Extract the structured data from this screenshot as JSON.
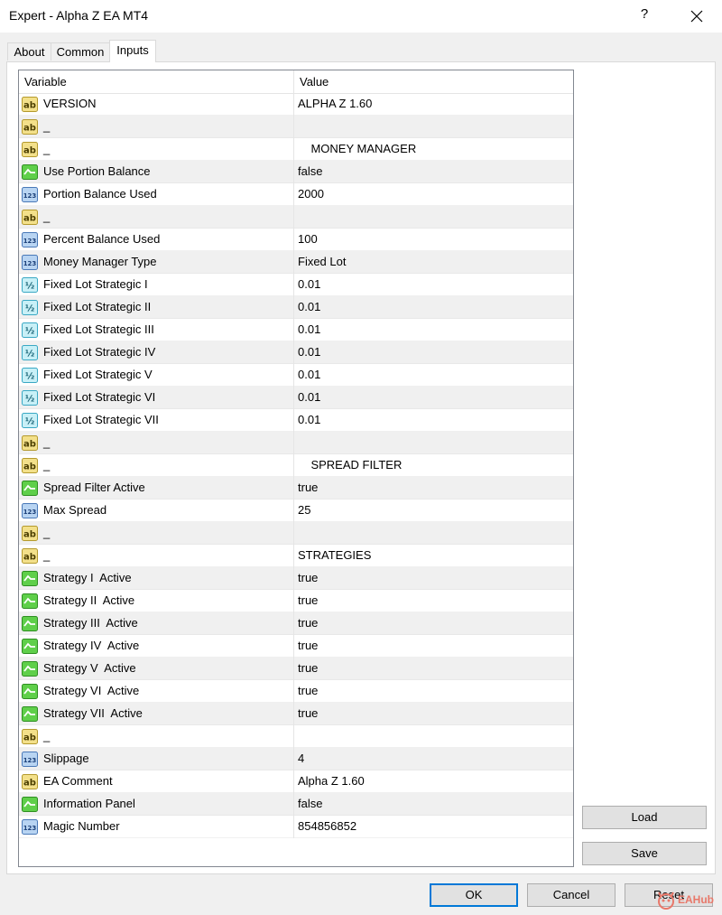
{
  "window": {
    "title": "Expert - Alpha Z EA MT4",
    "help_label": "?"
  },
  "tabs": [
    "About",
    "Common",
    "Inputs"
  ],
  "grid": {
    "headers": {
      "variable": "Variable",
      "value": "Value"
    },
    "rows": [
      {
        "icon": "ab",
        "name": "VERSION",
        "value": "ALPHA Z 1.60"
      },
      {
        "icon": "ab",
        "name": "_",
        "value": ""
      },
      {
        "icon": "ab",
        "name": "_",
        "value": "    MONEY MANAGER"
      },
      {
        "icon": "bool",
        "name": "Use Portion Balance",
        "value": "false"
      },
      {
        "icon": "int",
        "name": "Portion Balance Used",
        "value": "2000"
      },
      {
        "icon": "ab",
        "name": "_",
        "value": ""
      },
      {
        "icon": "int",
        "name": "Percent Balance Used",
        "value": "100"
      },
      {
        "icon": "int",
        "name": "Money Manager Type",
        "value": "Fixed Lot"
      },
      {
        "icon": "double",
        "name": "Fixed Lot Strategic I",
        "value": "0.01"
      },
      {
        "icon": "double",
        "name": "Fixed Lot Strategic II",
        "value": "0.01"
      },
      {
        "icon": "double",
        "name": "Fixed Lot Strategic III",
        "value": "0.01"
      },
      {
        "icon": "double",
        "name": "Fixed Lot Strategic IV",
        "value": "0.01"
      },
      {
        "icon": "double",
        "name": "Fixed Lot Strategic V",
        "value": "0.01"
      },
      {
        "icon": "double",
        "name": "Fixed Lot Strategic VI",
        "value": "0.01"
      },
      {
        "icon": "double",
        "name": "Fixed Lot Strategic VII",
        "value": "0.01"
      },
      {
        "icon": "ab",
        "name": "_",
        "value": ""
      },
      {
        "icon": "ab",
        "name": "_",
        "value": "    SPREAD FILTER"
      },
      {
        "icon": "bool",
        "name": "Spread Filter Active",
        "value": "true"
      },
      {
        "icon": "int",
        "name": "Max Spread",
        "value": "25"
      },
      {
        "icon": "ab",
        "name": "_",
        "value": ""
      },
      {
        "icon": "ab",
        "name": "_",
        "value": "STRATEGIES"
      },
      {
        "icon": "bool",
        "name": "Strategy I  Active",
        "value": "true"
      },
      {
        "icon": "bool",
        "name": "Strategy II  Active",
        "value": "true"
      },
      {
        "icon": "bool",
        "name": "Strategy III  Active",
        "value": "true"
      },
      {
        "icon": "bool",
        "name": "Strategy IV  Active",
        "value": "true"
      },
      {
        "icon": "bool",
        "name": "Strategy V  Active",
        "value": "true"
      },
      {
        "icon": "bool",
        "name": "Strategy VI  Active",
        "value": "true"
      },
      {
        "icon": "bool",
        "name": "Strategy VII  Active",
        "value": "true"
      },
      {
        "icon": "ab",
        "name": "_",
        "value": ""
      },
      {
        "icon": "int",
        "name": "Slippage",
        "value": "4"
      },
      {
        "icon": "ab",
        "name": "EA Comment",
        "value": "Alpha Z 1.60"
      },
      {
        "icon": "bool",
        "name": "Information Panel",
        "value": "false"
      },
      {
        "icon": "int",
        "name": "Magic Number",
        "value": "854856852"
      }
    ]
  },
  "side_buttons": {
    "load": "Load",
    "save": "Save"
  },
  "footer_buttons": {
    "ok": "OK",
    "cancel": "Cancel",
    "reset": "Reset"
  },
  "watermark": {
    "text": "EAHub"
  },
  "icon_styles": {
    "ab": {
      "label": "ab",
      "fill": "#f3e08a",
      "stroke": "#b49a2e",
      "text": "#4a3d00"
    },
    "int": {
      "label": "123",
      "fill": "#b8d4f2",
      "stroke": "#4a79b8",
      "text": "#1b3f78"
    },
    "double": {
      "label": "½",
      "fill": "#c8f0f7",
      "stroke": "#3aa8c4",
      "text": "#135f72"
    },
    "bool": {
      "label": "",
      "fill": "#5fcf4a",
      "stroke": "#2f8f22",
      "text": "#ffffff"
    }
  }
}
